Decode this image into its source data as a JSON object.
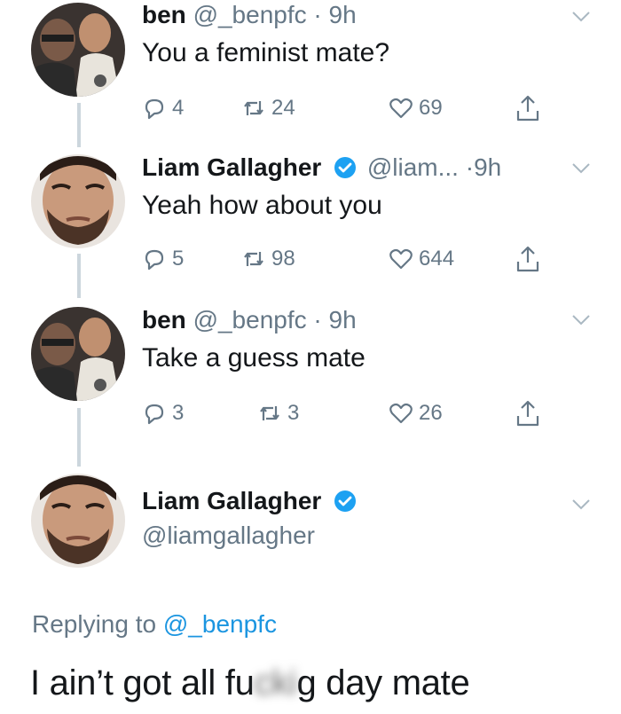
{
  "tweets": [
    {
      "name": "ben",
      "handle": "@_benpfc",
      "dot": "·",
      "time": "9h",
      "text": "You a feminist mate?",
      "replies": "4",
      "retweets": "24",
      "likes": "69",
      "avatar": "ben-avatar"
    },
    {
      "name": "Liam Gallagher",
      "handle": "@liam...",
      "dot": "·",
      "time": "9h",
      "text": "Yeah how about you",
      "replies": "5",
      "retweets": "98",
      "likes": "644",
      "avatar": "liam-avatar",
      "verified": true
    },
    {
      "name": "ben",
      "handle": "@_benpfc",
      "dot": "·",
      "time": "9h",
      "text": "Take a guess mate",
      "replies": "3",
      "retweets": "3",
      "likes": "26",
      "avatar": "ben-avatar"
    }
  ],
  "main_tweet": {
    "name": "Liam Gallagher",
    "handle": "@liamgallagher",
    "verified": true,
    "replying_prefix": "Replying to",
    "replying_mention": "@_benpfc",
    "text_start": "I ain’t got all fu",
    "text_blurred": "cki",
    "text_end": "g day mate"
  },
  "colors": {
    "text": "#14171a",
    "secondary": "#657786",
    "link": "#1b95e0",
    "verified": "#1da1f2",
    "thread_line": "#ccd6dd"
  },
  "icons": [
    "reply-icon",
    "retweet-icon",
    "like-icon",
    "share-icon",
    "verified-badge-icon",
    "chevron-down-icon"
  ]
}
